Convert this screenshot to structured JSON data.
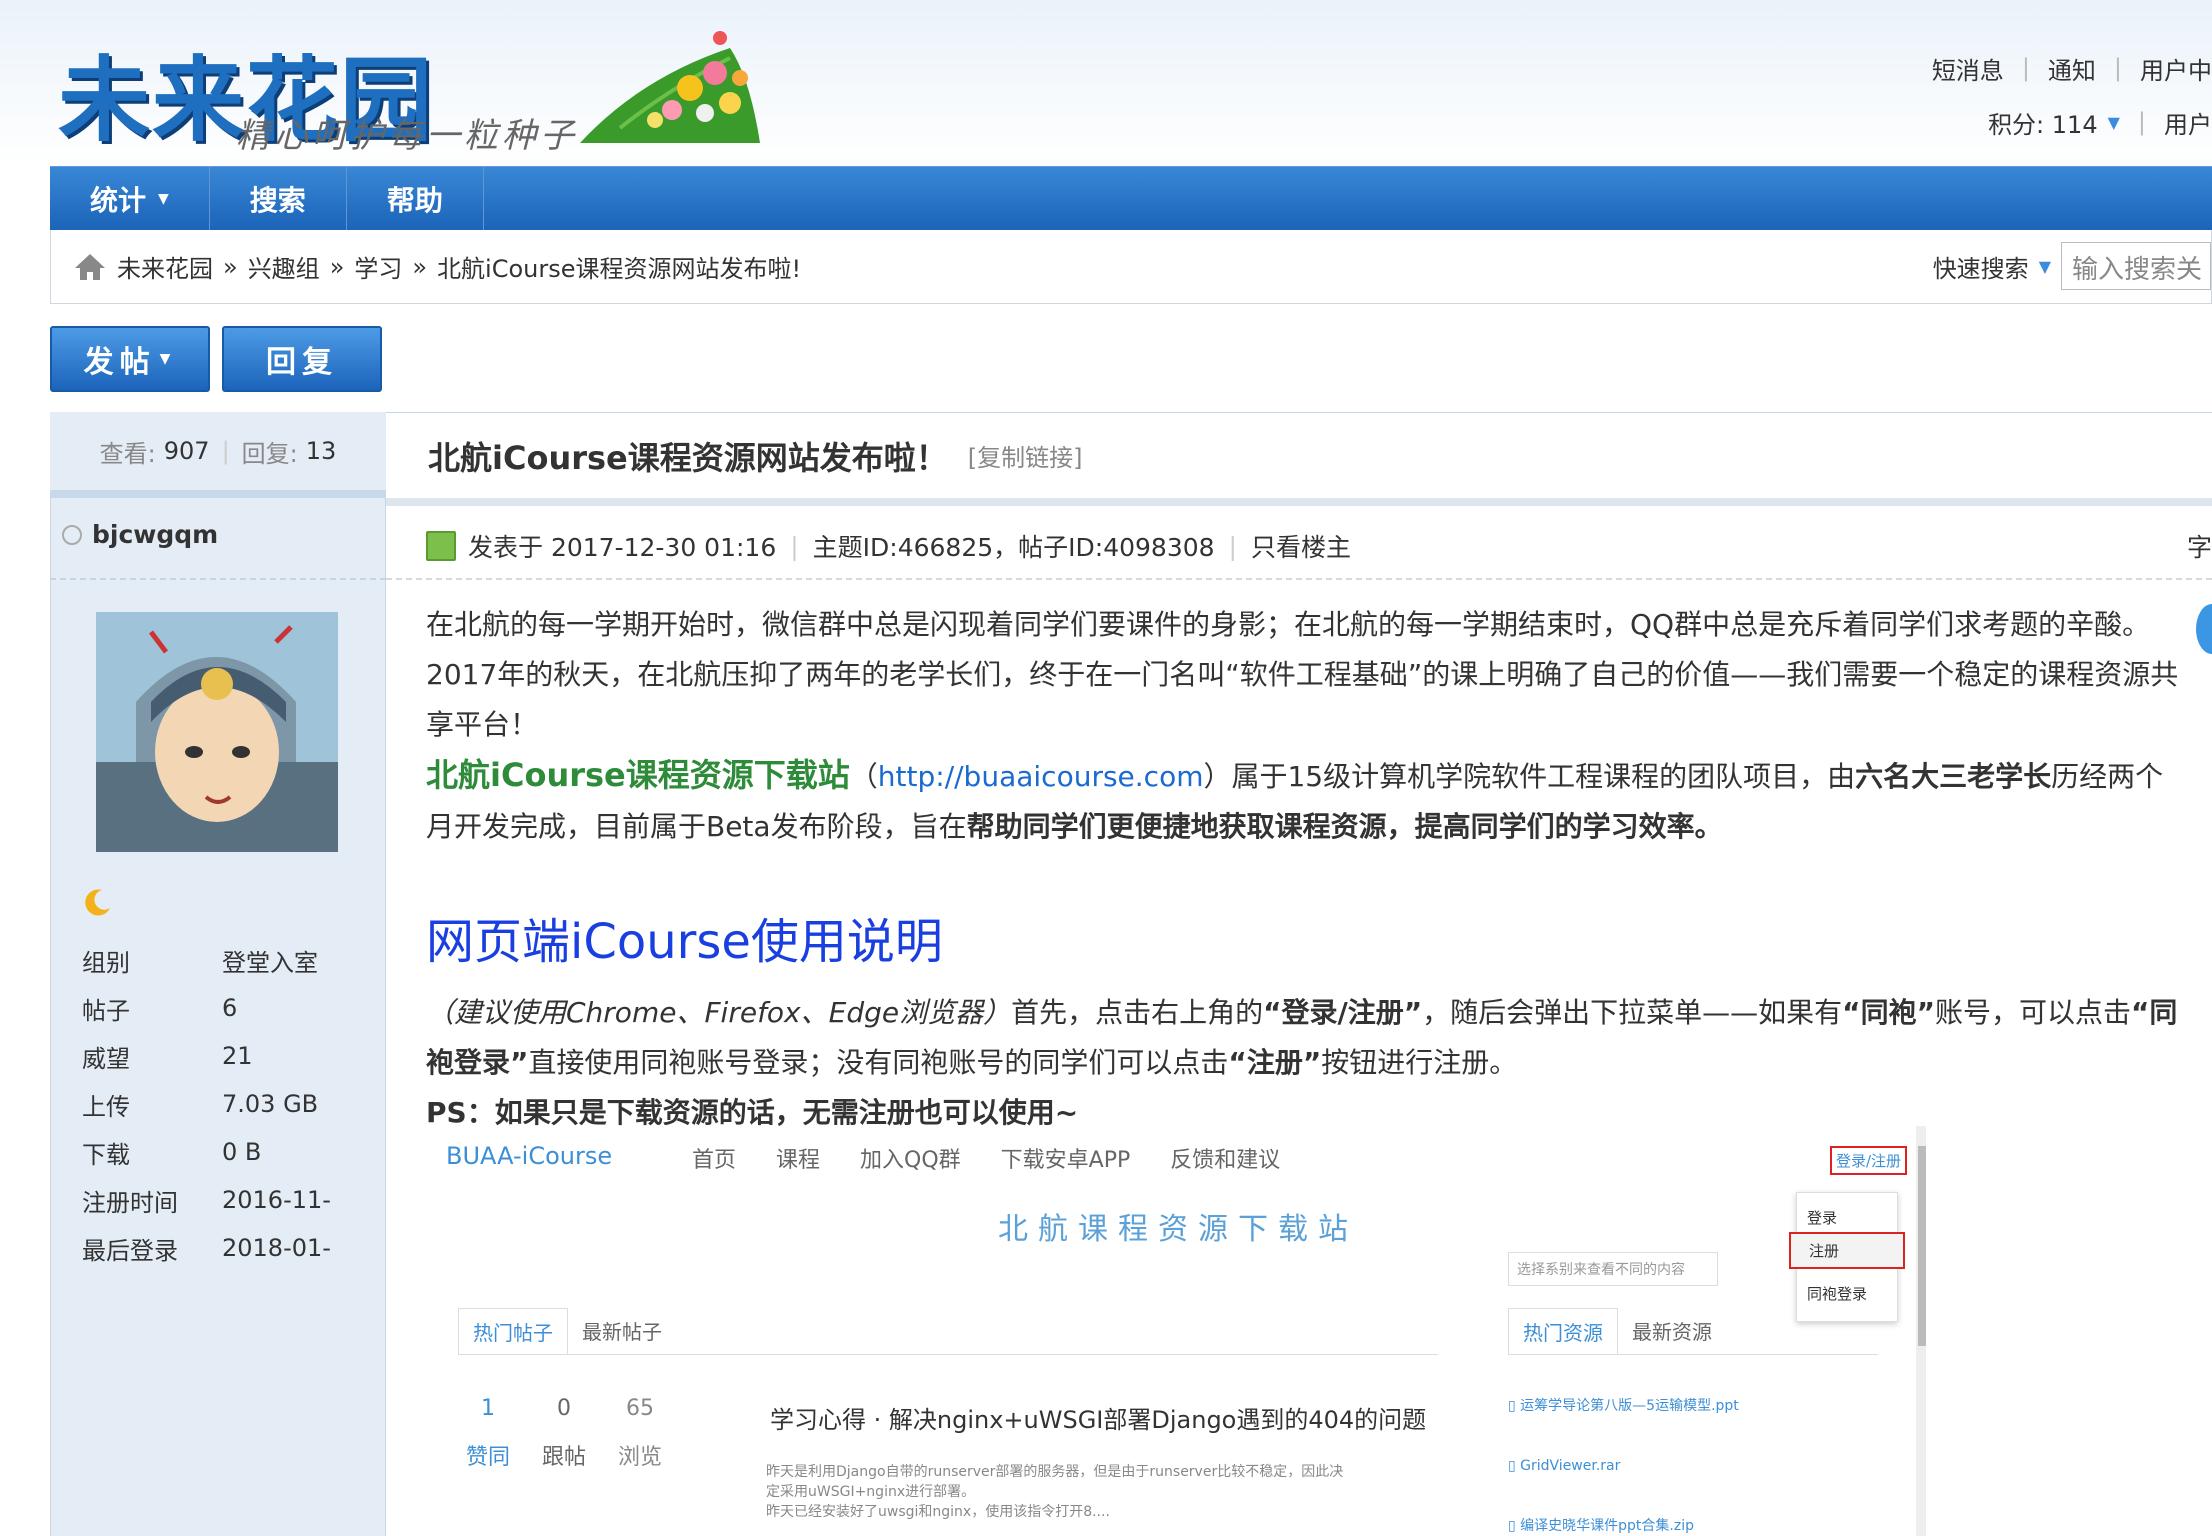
{
  "site": {
    "logo_text": "未来花园",
    "slogan": "精心呵护每一粒种子"
  },
  "userbar": {
    "messages": "短消息",
    "notice": "通知",
    "usercenter": "用户中",
    "points": "积分: 114",
    "user": "用户"
  },
  "nav": {
    "items": [
      {
        "label": "统计"
      },
      {
        "label": "搜索"
      },
      {
        "label": "帮助"
      }
    ]
  },
  "breadcrumb": {
    "home": "未来花园",
    "group": "兴趣组",
    "section": "学习",
    "current": "北航iCourse课程资源网站发布啦!",
    "sep": "»"
  },
  "quicksearch": {
    "label": "快速搜索",
    "placeholder": "输入搜索关"
  },
  "buttons": {
    "post": "发帖",
    "reply": "回复"
  },
  "stats": {
    "views_label": "查看:",
    "views": "907",
    "replies_label": "回复:",
    "replies": "13"
  },
  "author": {
    "name": "bjcwgqm",
    "profile": [
      {
        "label": "组别",
        "value": "登堂入室"
      },
      {
        "label": "帖子",
        "value": "6"
      },
      {
        "label": "威望",
        "value": "21"
      },
      {
        "label": "上传",
        "value": "7.03 GB"
      },
      {
        "label": "下载",
        "value": "0 B"
      },
      {
        "label": "注册时间",
        "value": "2016-11-"
      },
      {
        "label": "最后登录",
        "value": "2018-01-"
      }
    ]
  },
  "topic": {
    "title": "北航iCourse课程资源网站发布啦！",
    "copy_link": "[复制链接]",
    "posted": "发表于 2017-12-30 01:16",
    "ids": "主题ID:466825，帖子ID:4098308",
    "only_op": "只看楼主",
    "right_char": "字"
  },
  "post": {
    "p1": "在北航的每一学期开始时，微信群中总是闪现着同学们要课件的身影；在北航的每一学期结束时，QQ群中总是充斥着同学们求考题的辛酸。2017年的秋天，在北航压抑了两年的老学长们，终于在一门名叫“软件工程基础”的课上明确了自己的价值——我们需要一个稳定的课程资源共享平台！",
    "p2_green": "北航iCourse课程资源下载站",
    "p2_open": "（",
    "p2_link": "http://buaaicourse.com",
    "p2_a": "）属于15级计算机学院软件工程课程的团队项目，由",
    "p2_b1": "六名大三老学长",
    "p2_c": "历经两个月开发完成，目前属于Beta发布阶段，旨在",
    "p2_b2": "帮助同学们更便捷地获取课程资源，提高同学们的学习效率。",
    "h1": "网页端iCourse使用说明",
    "p3_i": "（建议使用Chrome、Firefox、Edge浏览器）",
    "p3_a": "首先，点击右上角的",
    "p3_b1": "“登录/注册”",
    "p3_c": "，随后会弹出下拉菜单——如果有",
    "p3_b2": "“同袍”",
    "p3_d": "账号，可以点击",
    "p3_b3": "“同袍登录”",
    "p3_e": "直接使用同袍账号登录；没有同袍账号的同学们可以点击",
    "p3_b4": "“注册”",
    "p3_f": "按钮进行注册。",
    "ps": "PS：如果只是下载资源的话，无需注册也可以使用~"
  },
  "screenshot": {
    "brand": "BUAA-iCourse",
    "nav": [
      "首页",
      "课程",
      "加入QQ群",
      "下载安卓APP",
      "反馈和建议"
    ],
    "login": "登录/注册",
    "dropdown": [
      "登录",
      "注册",
      "同袍登录"
    ],
    "hero": "北航课程资源下载站",
    "select": "选择系别来查看不同的内容",
    "tabs_left": [
      "热门帖子",
      "最新帖子"
    ],
    "tabs_right": [
      "热门资源",
      "最新资源"
    ],
    "post_stats": [
      {
        "num": "1",
        "label": "赞同"
      },
      {
        "num": "0",
        "label": "跟帖"
      },
      {
        "num": "65",
        "label": "浏览"
      }
    ],
    "post_title": "学习心得 · 解决nginx+uWSGI部署Django遇到的404的问题",
    "post_excerpt_1": "昨天是利用Django自带的runserver部署的服务器，但是由于runserver比较不稳定，因此决",
    "post_excerpt_2": "定采用uWSGI+nginx进行部署。",
    "post_excerpt_3": "昨天已经安装好了uwsgi和nginx，使用该指令打开8....",
    "files": [
      "运筹学导论第八版—5运输模型.ppt",
      "GridViewer.rar",
      "编译史晓华课件ppt合集.zip"
    ]
  }
}
